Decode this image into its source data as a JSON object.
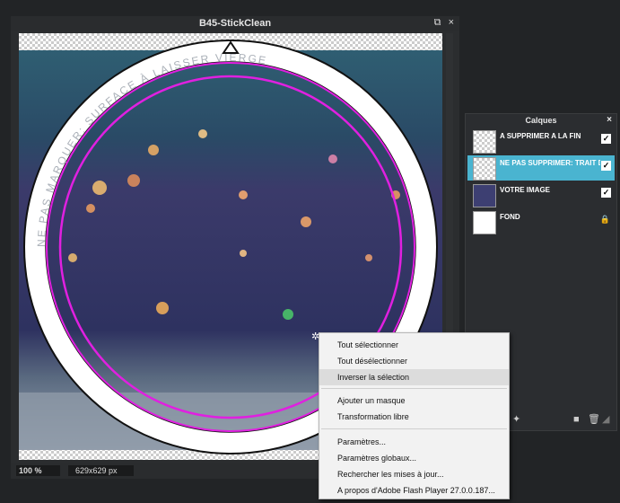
{
  "document": {
    "title": "B45-StickClean",
    "restore_icon": "restore-window-icon",
    "close_icon": "close-icon",
    "close_glyph": "×",
    "ring_text": "NE PAS MARQUER: SURFACE À LAISSER VIERGE",
    "zoom": "100 %",
    "dimensions": "629x629 px"
  },
  "colors": {
    "selection_ring": "#e020e0",
    "layer_selected": "#4ab4d0",
    "panel_bg": "#2b2d30",
    "menu_bg": "#f2f2f2"
  },
  "layers_panel": {
    "title": "Calques",
    "close_glyph": "×",
    "layers": [
      {
        "name": "A SUPPRIMER A LA FIN",
        "visible": true,
        "selected": false,
        "locked": false
      },
      {
        "name": "NE PAS SUPPRIMER: TRAIT DE COUPE",
        "visible": true,
        "selected": true,
        "locked": false
      },
      {
        "name": "VOTRE IMAGE",
        "visible": true,
        "selected": false,
        "locked": false
      },
      {
        "name": "FOND",
        "visible": false,
        "selected": false,
        "locked": true
      }
    ],
    "check_glyph": "✓",
    "lock_glyph": "🔒",
    "footer_icons": [
      "layer-style-icon",
      "new-layer-icon",
      "new-folder-icon",
      "delete-icon",
      "expand-icon"
    ]
  },
  "context_menu": {
    "items": [
      {
        "label": "Tout sélectionner",
        "highlighted": false
      },
      {
        "label": "Tout désélectionner",
        "highlighted": false
      },
      {
        "label": "Inverser la sélection",
        "highlighted": true
      },
      {
        "label": "Ajouter un masque",
        "highlighted": false
      },
      {
        "label": "Transformation libre",
        "highlighted": false
      },
      {
        "label": "Paramètres...",
        "highlighted": false
      },
      {
        "label": "Paramètres globaux...",
        "highlighted": false
      },
      {
        "label": "Rechercher les mises à jour...",
        "highlighted": false
      },
      {
        "label": "A propos d'Adobe Flash Player 27.0.0.187...",
        "highlighted": false
      }
    ]
  }
}
